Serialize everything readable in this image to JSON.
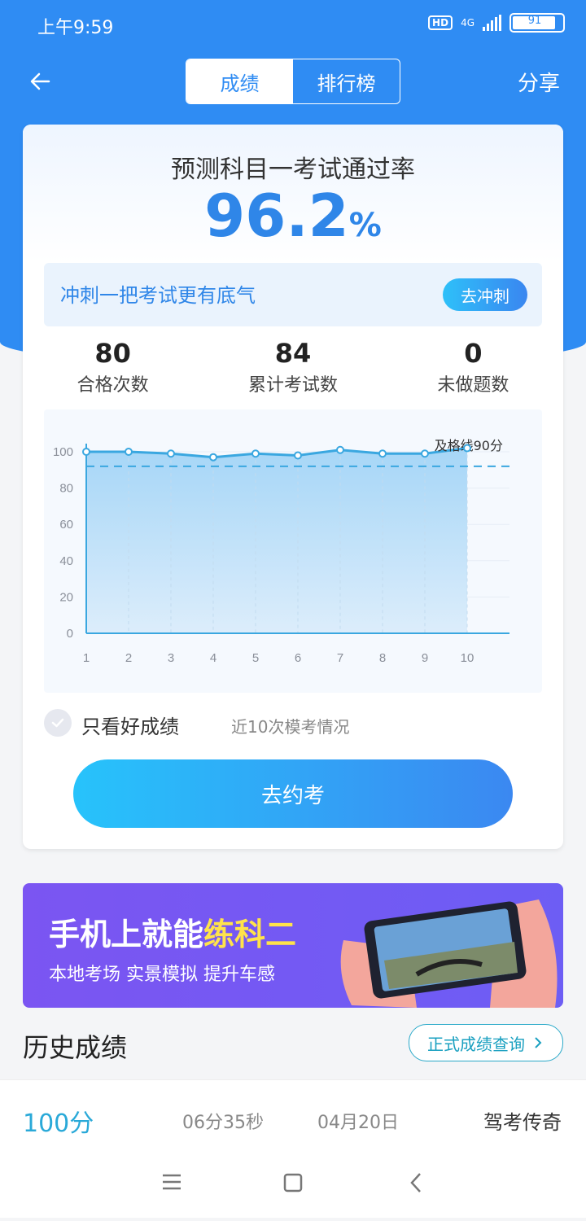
{
  "status": {
    "time": "上午9:59",
    "hd": "HD",
    "network": "4G",
    "battery": "91"
  },
  "nav": {
    "tabs": [
      "成绩",
      "排行榜"
    ],
    "active_tab": 0,
    "share": "分享"
  },
  "prediction": {
    "title": "预测科目一考试通过率",
    "value": "96.2",
    "unit": "%"
  },
  "sprint": {
    "text": "冲刺一把考试更有底气",
    "button": "去冲刺"
  },
  "stats": [
    {
      "value": "80",
      "label": "合格次数"
    },
    {
      "value": "84",
      "label": "累计考试数"
    },
    {
      "value": "0",
      "label": "未做题数"
    }
  ],
  "chart_data": {
    "type": "area",
    "x": [
      1,
      2,
      3,
      4,
      5,
      6,
      7,
      8,
      9,
      10
    ],
    "y": [
      100,
      100,
      99,
      97,
      99,
      98,
      101,
      99,
      99,
      102
    ],
    "yticks": [
      0,
      20,
      40,
      60,
      80,
      100
    ],
    "ylim": [
      0,
      110
    ],
    "pass_line": {
      "value": 92,
      "label": "及格线90分"
    },
    "grid": true
  },
  "filter": {
    "label": "只看好成绩",
    "note": "近10次模考情况"
  },
  "book_button": "去约考",
  "banner": {
    "title_a": "手机上就能",
    "title_b": "练科二",
    "subtitle": "本地考场 实景模拟 提升车感"
  },
  "history": {
    "title": "历史成绩",
    "query_button": "正式成绩查询",
    "rows": [
      {
        "score": "100分",
        "duration": "06分35秒",
        "date": "04月20日",
        "source": "驾考传奇"
      }
    ]
  },
  "colors": {
    "primary": "#2f8cf3",
    "accent": "#2f86e8",
    "banner": "#7356f2",
    "highlight": "#ffe34a"
  }
}
